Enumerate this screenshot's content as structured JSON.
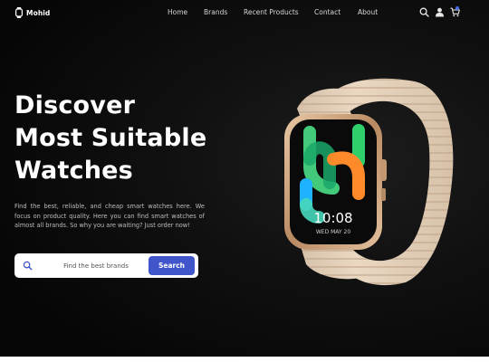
{
  "brand": {
    "name": "Mohid",
    "logo_icon": "watch-icon"
  },
  "nav": {
    "links": [
      "Home",
      "Brands",
      "Recent Products",
      "Contact",
      "About"
    ],
    "icons": [
      "search-icon",
      "user-icon",
      "cart-icon"
    ]
  },
  "hero": {
    "title_lines": [
      "Discover",
      "Most Suitable",
      "Watches"
    ],
    "description": "Find the best, reliable, and cheap smart watches here. We focus on product quality. Here you can find smart watches of almost all brands. So why you are waiting? Just order now!"
  },
  "search": {
    "placeholder": "Find the best brands",
    "button_label": "Search"
  },
  "watch": {
    "time": "10:08",
    "date_line": "WED   MAY 20"
  },
  "colors": {
    "background": "#0b0b0b",
    "accent": "#3f55c9",
    "text": "#ffffff",
    "strap": "#e6d2bd"
  }
}
